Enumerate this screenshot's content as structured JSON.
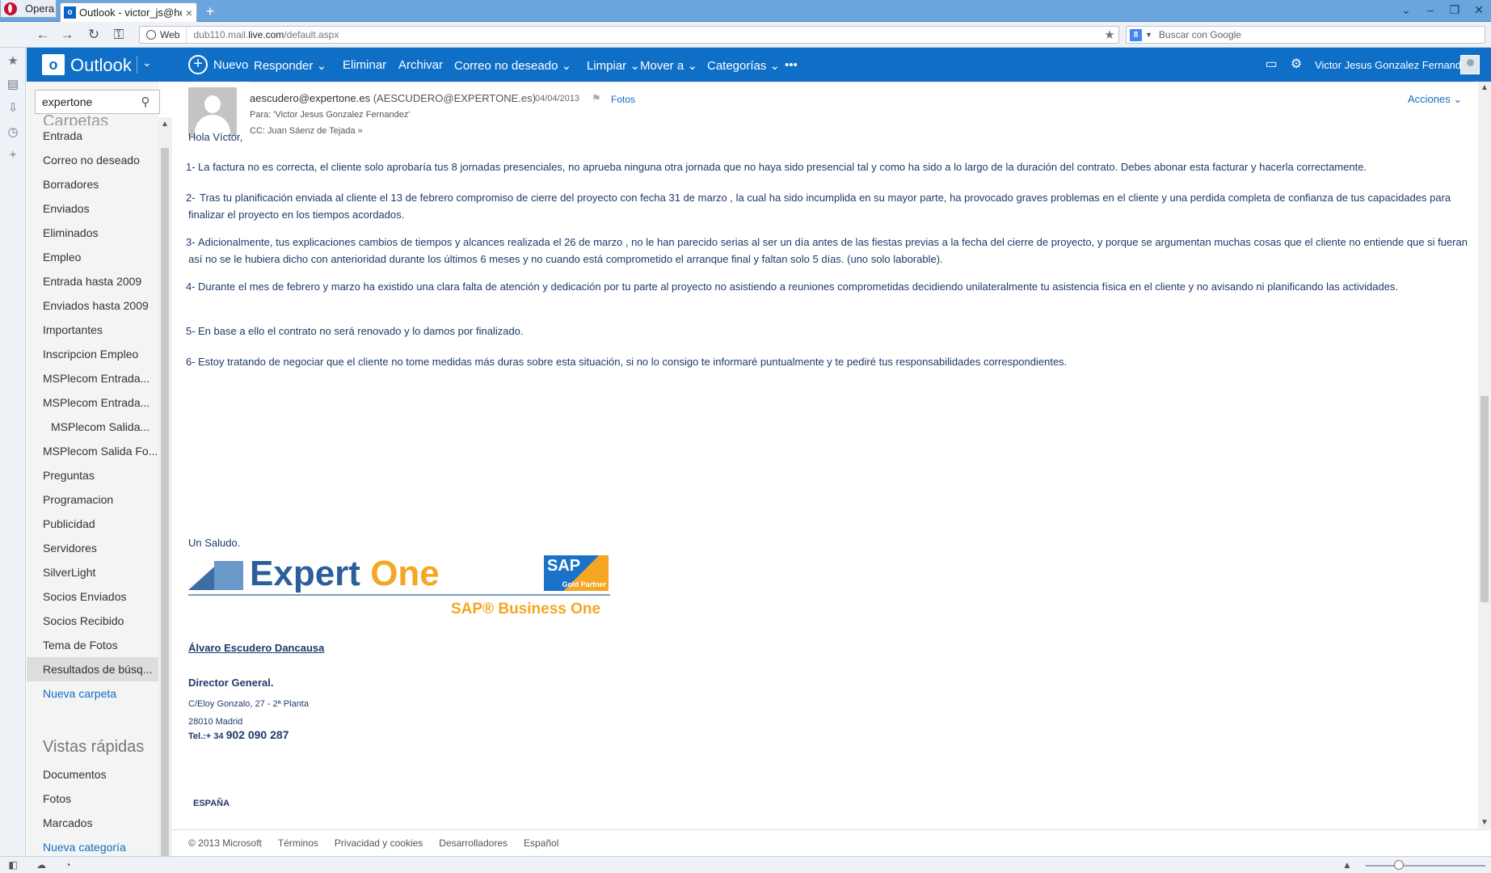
{
  "browser": {
    "menu_label": "Opera",
    "tab_title": "Outlook - victor_js@ho...",
    "tab_favicon": "o",
    "tab_close": "×",
    "new_tab": "+",
    "url_mode": "Web",
    "url_prefix": "dub110.mail.",
    "url_domain": "live.com",
    "url_suffix": "/default.aspx",
    "search_engine_icon": "8",
    "search_placeholder": "Buscar con Google"
  },
  "outlook": {
    "app_name": "Outlook",
    "logo_letter": "o",
    "commands": {
      "new": "Nuevo",
      "reply": "Responder",
      "delete": "Eliminar",
      "archive": "Archivar",
      "junk": "Correo no deseado",
      "sweep": "Limpiar",
      "move": "Mover a",
      "categories": "Categorías",
      "more": "•••"
    },
    "user_name": "Victor Jesus Gonzalez Fernandez"
  },
  "folders": {
    "search_value": "expertone",
    "header": "Carpetas",
    "items": [
      {
        "label": "Entrada"
      },
      {
        "label": "Correo no deseado"
      },
      {
        "label": "Borradores"
      },
      {
        "label": "Enviados"
      },
      {
        "label": "Eliminados"
      },
      {
        "label": "Empleo"
      },
      {
        "label": "Entrada hasta 2009"
      },
      {
        "label": "Enviados hasta 2009"
      },
      {
        "label": "Importantes"
      },
      {
        "label": "Inscripcion Empleo"
      },
      {
        "label": "MSPlecom Entrada..."
      },
      {
        "label": "MSPlecom Entrada..."
      },
      {
        "label": "MSPlecom Salida..."
      },
      {
        "label": "MSPlecom Salida Fo..."
      },
      {
        "label": "Preguntas"
      },
      {
        "label": "Programacion"
      },
      {
        "label": "Publicidad"
      },
      {
        "label": "Servidores"
      },
      {
        "label": "SilverLight"
      },
      {
        "label": "Socios Enviados"
      },
      {
        "label": "Socios Recibido"
      },
      {
        "label": "Tema de Fotos"
      },
      {
        "label": "Resultados de búsq..."
      }
    ],
    "new_folder": "Nueva carpeta",
    "quick_views_header": "Vistas rápidas",
    "quick_views": [
      {
        "label": "Documentos"
      },
      {
        "label": "Fotos"
      },
      {
        "label": "Marcados"
      }
    ],
    "new_category": "Nueva categoría"
  },
  "message": {
    "from_email": "aescudero@expertone.es",
    "from_display": "(AESCUDERO@EXPERTONE.es)",
    "date": "04/04/2013",
    "photos_link": "Fotos",
    "to": "Para: 'Victor Jesus Gonzalez Fernandez'",
    "cc": "CC: Juan Sáenz de Tejada",
    "cc_expand": "»",
    "actions": "Acciones",
    "greeting": "Hola Víctor,",
    "paragraphs": [
      {
        "num": "1-",
        "text": "La factura no es correcta, el cliente solo aprobaría  tus 8 jornadas presenciales, no aprueba ninguna otra jornada que no haya sido presencial tal y como ha sido a lo largo de la duración del contrato.  Debes abonar esta facturar y hacerla correctamente."
      },
      {
        "num": "2-",
        "text": "Tras tu planificación enviada al cliente el 13 de febrero  compromiso de cierre del proyecto con fecha 31 de marzo , la cual ha sido incumplida en su mayor parte, ha provocado graves problemas en el cliente y una perdida completa de confianza de tus capacidades para finalizar el proyecto en los tiempos acordados."
      },
      {
        "num": "3-",
        "text": "Adicionalmente, tus explicaciones cambios de tiempos y alcances realizada el 26 de marzo , no le han parecido serias al ser un día antes de las fiestas previas a la fecha del cierre de proyecto, y porque se argumentan muchas cosas que el cliente no entiende que si fueran así no se le hubiera dicho con anterioridad durante los últimos 6 meses  y no cuando está comprometido el arranque final y faltan solo 5 días. (uno solo laborable)."
      },
      {
        "num": "4-",
        "text": "Durante el mes de febrero y marzo ha existido una clara falta de atención y dedicación por tu parte al proyecto no asistiendo a reuniones comprometidas decidiendo unilateralmente tu asistencia física en el cliente y no avisando ni planificando las actividades."
      },
      {
        "num": "5-",
        "text": "En base a ello el contrato no será renovado y lo damos por finalizado."
      },
      {
        "num": "6-",
        "text": "Estoy tratando de negociar que el cliente no tome medidas más duras sobre esta situación, si no lo consigo te informaré puntualmente y te pediré tus responsabilidades correspondientes."
      }
    ],
    "closing": "Un Saludo.",
    "logo_expert": "Expert",
    "logo_one": "One",
    "logo_sap": "SAP",
    "logo_gold_partner": "Gold Partner",
    "logo_business_one": "SAP® Business One",
    "signature": {
      "name": "Álvaro Escudero Dancausa",
      "title": "Director General.",
      "address1": "C/Eloy Gonzalo, 27 - 2ª Planta",
      "address2": "28010 Madrid",
      "tel_prefix": "Tel.:+ 34 ",
      "tel_number": "902 090 287",
      "country": "ESPAÑA"
    }
  },
  "footer": {
    "copyright": "© 2013 Microsoft",
    "terms": "Términos",
    "privacy": "Privacidad y cookies",
    "developers": "Desarrolladores",
    "language": "Español"
  },
  "colors": {
    "outlook_blue": "#0f6ec6",
    "body_text": "#1f3a6a",
    "expert_one_orange": "#f5a623"
  }
}
